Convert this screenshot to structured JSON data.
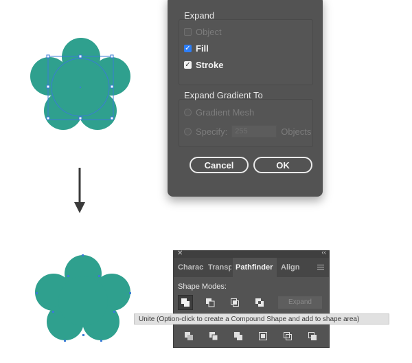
{
  "expand_dialog": {
    "expand_title": "Expand",
    "options": [
      {
        "label": "Object",
        "checked": false,
        "disabled": true
      },
      {
        "label": "Fill",
        "checked": true,
        "disabled": false
      },
      {
        "label": "Stroke",
        "checked": true,
        "disabled": false
      }
    ],
    "gradient_title": "Expand Gradient To",
    "gradient_mesh_label": "Gradient Mesh",
    "specify_label": "Specify:",
    "specify_value": "255",
    "objects_label": "Objects",
    "cancel_label": "Cancel",
    "ok_label": "OK"
  },
  "pathfinder_panel": {
    "tabs": [
      "Charac",
      "Transp",
      "Pathfinder",
      "Align"
    ],
    "active_tab": "Pathfinder",
    "shape_modes_label": "Shape Modes:",
    "expand_label": "Expand"
  },
  "tooltip": {
    "text": "Unite (Option-click to create a Compound Shape and add to shape area)"
  },
  "colors": {
    "shape_fill": "#2fa08e",
    "selection_blue": "#3a7bd5",
    "dialog_bg": "#535353"
  },
  "icons": {
    "arrow": "down-arrow-icon",
    "close": "close-icon",
    "collapse": "double-chevron-icon",
    "menu": "panel-menu-icon"
  }
}
